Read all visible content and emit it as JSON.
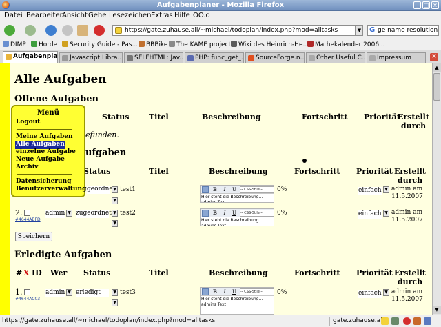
{
  "window": {
    "title": "Aufgabenplaner - Mozilla Firefox"
  },
  "menubar": [
    "Datei",
    "Bearbeiten",
    "Ansicht",
    "Gehe",
    "Lesezeichen",
    "Extras",
    "Hilfe",
    "OO.o"
  ],
  "nav": {
    "url": "https://gate.zuhause.all/~michael/todoplan/index.php?mod=alltasks",
    "search_value": "ge name resolution"
  },
  "bookmarks": [
    "DIMP",
    "Horde",
    "Security Guide - Pas...",
    "BBBike",
    "The KAME project",
    "Wiki des Heinrich-He...",
    "Mathekalender 2006..."
  ],
  "tabs": [
    "Aufgabenpla...",
    "Javascript Libra...",
    "SELFHTML: Jav...",
    "PHP: func_get_...",
    "SourceForge.n...",
    "Other Useful C...",
    "Impressum"
  ],
  "colors": {
    "page_bg": "#ffffe0",
    "sidebar_bar": "#ffff00",
    "menu_bg": "#ffff33",
    "menu_selected": "#1a2a9a",
    "delete_x": "#d01010"
  },
  "page": {
    "title": "Alle Aufgaben",
    "open_heading": "Offene Aufgaben",
    "open_note": "efunden.",
    "second_heading": "ufgaben",
    "done_heading": "Erledigte Aufgaben",
    "save_label": "Speichern"
  },
  "columns": {
    "status": "Status",
    "titel": "Titel",
    "beschreibung": "Beschreibung",
    "fortschritt": "Fortschritt",
    "prioritaet": "Priorität",
    "erstellt1": "Erstellt",
    "erstellt2": "durch",
    "nr": "#",
    "x": "X",
    "id": "ID",
    "wer": "Wer"
  },
  "editor": {
    "placeholder_style": "-- CSS-Stile --",
    "text": "Hier steht die Beschreibung...",
    "text2": "admins Text"
  },
  "tasks_second": [
    {
      "num": "",
      "id": "",
      "who": "",
      "status": "geordnet",
      "title": "test1",
      "progress": "0%",
      "priority": "einfach",
      "created_by": "admin am",
      "created_date": "11.5.2007"
    },
    {
      "num": "2.",
      "id": "#4644ABFD",
      "who": "admin",
      "status": "zugeordnet",
      "title": "test2",
      "progress": "0%",
      "priority": "einfach",
      "created_by": "admin am",
      "created_date": "11.5.2007"
    }
  ],
  "tasks_done": [
    {
      "num": "1.",
      "id": "#4644AC03",
      "who": "admin",
      "status": "erledigt",
      "title": "test3",
      "progress": "0%",
      "priority": "einfach",
      "created_by": "admin am",
      "created_date": "11.5.2007"
    }
  ],
  "menu": {
    "title": "Menü",
    "logout": "Logout",
    "items": [
      "Meine Aufgaben",
      "Alle Aufgaben",
      "einzelne Aufgabe",
      "Neue Aufgabe",
      "Archiv"
    ],
    "admin": [
      "Datensicherung",
      "Benutzerverwaltung"
    ]
  },
  "status": {
    "text": "https://gate.zuhause.all/~michael/todoplan/index.php?mod=alltasks",
    "host": "gate.zuhause.all"
  }
}
